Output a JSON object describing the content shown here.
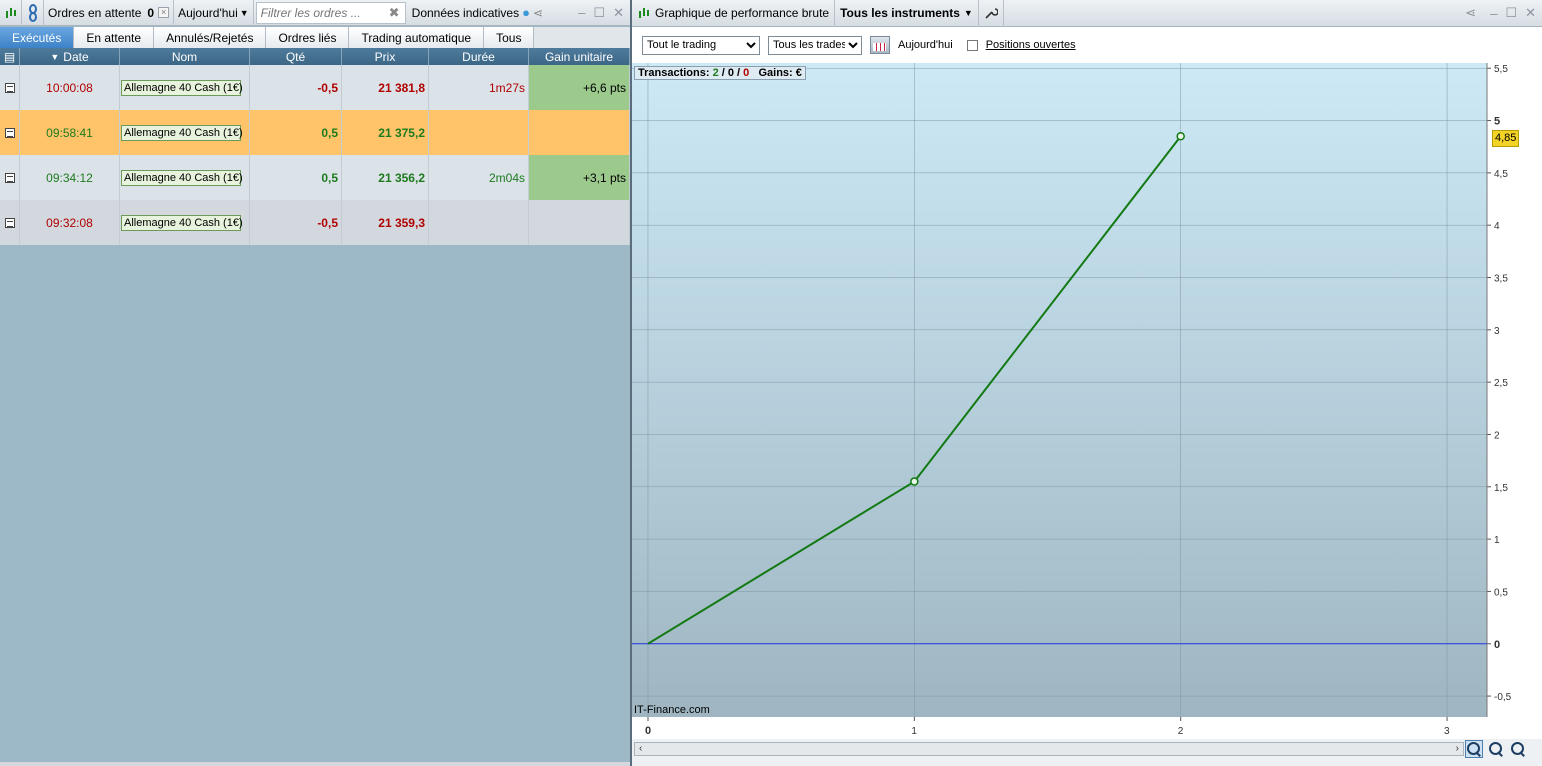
{
  "left": {
    "pending_label": "Ordres en attente",
    "pending_count": "0",
    "period": "Aujourd'hui",
    "filter_placeholder": "Filtrer les ordres ...",
    "data_label": "Données indicatives",
    "tabs": [
      "Exécutés",
      "En attente",
      "Annulés/Rejetés",
      "Ordres liés",
      "Trading automatique",
      "Tous"
    ],
    "columns": [
      "Date",
      "Nom",
      "Qté",
      "Prix",
      "Durée",
      "Gain unitaire"
    ],
    "rows": [
      {
        "date": "10:00:08",
        "nom": "Allemagne 40 Cash (1€)",
        "qte": "-0,5",
        "prix": "21 381,8",
        "duree": "1m27s",
        "gain": "+6,6 pts",
        "bg": "#dbe3e9",
        "color": "#b00000",
        "gain_bg": "#9cc98c"
      },
      {
        "date": "09:58:41",
        "nom": "Allemagne 40 Cash (1€)",
        "qte": "0,5",
        "prix": "21 375,2",
        "duree": "",
        "gain": "",
        "bg": "#ffc46a",
        "color": "#1e7a1e",
        "gain_bg": "#ffc46a"
      },
      {
        "date": "09:34:12",
        "nom": "Allemagne 40 Cash (1€)",
        "qte": "0,5",
        "prix": "21 356,2",
        "duree": "2m04s",
        "gain": "+3,1 pts",
        "bg": "#dbe3e9",
        "color": "#1e7a1e",
        "gain_bg": "#9cc98c"
      },
      {
        "date": "09:32:08",
        "nom": "Allemagne 40 Cash (1€)",
        "qte": "-0,5",
        "prix": "21 359,3",
        "duree": "",
        "gain": "",
        "bg": "#d2d8de",
        "color": "#b00000",
        "gain_bg": "#d2d8de"
      }
    ]
  },
  "right": {
    "title": "Graphique de performance brute",
    "instruments": "Tous les instruments",
    "trading_select": "Tout le trading",
    "trades_select": "Tous les trades",
    "date_label": "Aujourd'hui",
    "positions_label": "Positions ouvertes",
    "info_prefix": "Transactions: ",
    "info_won": "2",
    "info_sep1": " / ",
    "info_even": "0",
    "info_sep2": " / ",
    "info_lost": "0",
    "info_gains": "   Gains: €",
    "watermark": "IT-Finance.com",
    "last_value": "4,85"
  },
  "chart_data": {
    "type": "line",
    "x": [
      0,
      1,
      2
    ],
    "y": [
      0,
      1.55,
      4.85
    ],
    "xlim": [
      -0.06,
      3.15
    ],
    "ylim": [
      -0.7,
      5.55
    ],
    "xticks": [
      0,
      1,
      2,
      3
    ],
    "yticks": [
      -0.5,
      0,
      0.5,
      1,
      1.5,
      2,
      2.5,
      3,
      3.5,
      4,
      4.5,
      5,
      5.5
    ],
    "ytick_labels": [
      "-0,5",
      "0",
      "0,5",
      "1",
      "1,5",
      "2",
      "2,5",
      "3",
      "3,5",
      "4",
      "4,5",
      "5",
      "5,5"
    ],
    "line_color": "#137a13",
    "zero_line_color": "#2233dd",
    "grid": true
  }
}
